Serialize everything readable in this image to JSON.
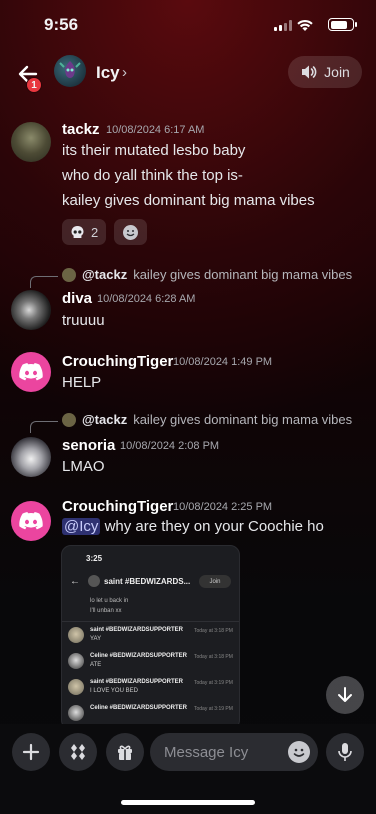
{
  "status_bar": {
    "time": "9:56"
  },
  "header": {
    "back_badge": "1",
    "title": "Icy",
    "chevron": "›",
    "join_label": "Join"
  },
  "messages": [
    {
      "author": "tackz",
      "timestamp": "10/08/2024 6:17 AM",
      "lines": [
        "its their mutated lesbo baby",
        "who do yall think the top is-",
        "kailey gives dominant big mama vibes"
      ],
      "reactions": [
        {
          "emoji": "skull",
          "count": "2"
        },
        {
          "emoji": "add-reaction",
          "count": ""
        }
      ]
    },
    {
      "author": "diva",
      "timestamp": "10/08/2024 6:28 AM",
      "reply": {
        "to": "@tackz",
        "text": "kailey gives dominant big mama vibes"
      },
      "lines": [
        "truuuu"
      ]
    },
    {
      "author": "CrouchingTiger",
      "timestamp": "10/08/2024 1:49 PM",
      "lines": [
        "HELP"
      ]
    },
    {
      "author": "senoria",
      "timestamp": "10/08/2024 2:08 PM",
      "reply": {
        "to": "@tackz",
        "text": "kailey gives dominant big mama vibes"
      },
      "lines": [
        "LMAO"
      ]
    },
    {
      "author": "CrouchingTiger",
      "timestamp": "10/08/2024 2:25 PM",
      "mention": "@Icy",
      "text": " why are they on your Coochie ho"
    }
  ],
  "attachment": {
    "time": "3:25",
    "title": "saint #BEDWIZARDS...",
    "join_label": "Join",
    "top_lines": [
      "lo let u back in",
      "I'll unban xx"
    ],
    "rows": [
      {
        "name": "saint #BEDWIZARDSUPPORTER",
        "time": "Today at 3:18 PM",
        "text": "YAY"
      },
      {
        "name": "Celine #BEDWIZARDSUPPORTER",
        "time": "Today at 3:18 PM",
        "text": "ATE"
      },
      {
        "name": "saint #BEDWIZARDSUPPORTER",
        "time": "Today at 3:19 PM",
        "text": "I LOVE YOU BED"
      },
      {
        "name": "Celine #BEDWIZARDSUPPORTER",
        "time": "Today at 3:19 PM",
        "text": ""
      }
    ]
  },
  "composer": {
    "placeholder": "Message Icy"
  },
  "colors": {
    "accent": "#eb459f",
    "mention_bg": "#5865f2",
    "badge": "#e8373f"
  }
}
